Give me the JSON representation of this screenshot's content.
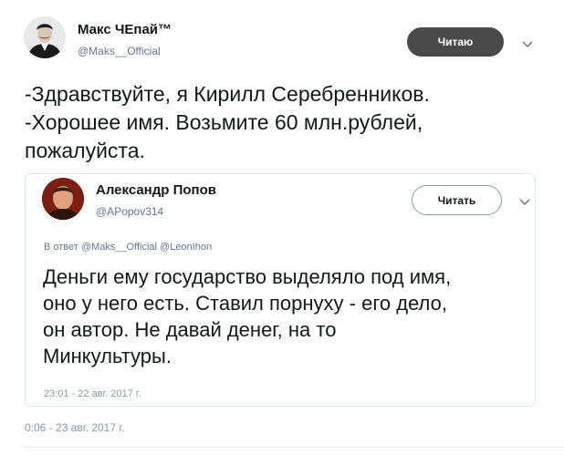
{
  "main_tweet": {
    "author_name": "Макс ЧЕпай™",
    "author_handle": "@Maks__Official",
    "follow_label": "Читаю",
    "text": "-Здравствуйте, я Кирилл Серебренников.\n-Хорошее имя. Возьмите 60 млн.рублей,\nпожалуйста.",
    "timestamp": "0:06 - 23 авг. 2017 г."
  },
  "quoted_tweet": {
    "author_name": "Александр Попов",
    "author_handle": "@APopov314",
    "follow_label": "Читать",
    "reply_to": "В ответ @Maks__Official @LeonIhon",
    "text": "Деньги ему государство выделяло под имя,\nоно у него есть. Ставил порнуху - его дело,\nон автор. Не давай денег, на то\nМинкультуры.",
    "timestamp": "23:01 - 22 авг. 2017 г."
  },
  "icons": {
    "more": "chevron-down-icon"
  },
  "colors": {
    "text": "#14171a",
    "secondary": "#657786",
    "follow_dark": "#4a4a4a",
    "border": "#e1e8ed"
  }
}
